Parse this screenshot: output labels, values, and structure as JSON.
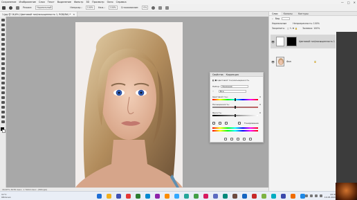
{
  "menubar": {
    "items": [
      "Сохранение",
      "Изображение",
      "Слои",
      "Текст",
      "Выделение",
      "Фильтр",
      "3D",
      "Просмотр",
      "Окно",
      "Справка"
    ],
    "window_controls": [
      "—",
      "□",
      "✕"
    ]
  },
  "options_bar": {
    "mode_label": "Режим:",
    "mode_value": "Нормальный",
    "opacity_label": "Непрозр.:",
    "opacity_value": "100%",
    "flow_label": "Наж.:",
    "flow_value": "100%",
    "smoothing_label": "Сглаживание:",
    "smoothing_value": "0%"
  },
  "document_tab": {
    "title": "1.jpg @ 16,6% (Цветовой тон/насыщенность 1, RGB/8#) *",
    "close": "✕"
  },
  "statusbar": {
    "text": "16,67%    3476 пикс. × 5214 пикс. (300 ppi)"
  },
  "right_panel": {
    "tabs": [
      "Слои",
      "Каналы",
      "Контуры"
    ],
    "active_tab": "Слои",
    "filter_label": "Вид",
    "blend_label": "Нормальные",
    "opacity_label": "Непрозрачность: 100%",
    "lock_label": "Закрепить:",
    "fill_label": "Заливка: 100%",
    "layers": [
      {
        "name": "Цветовой тон/насыщенность 1",
        "selected": true
      },
      {
        "name": "Фон",
        "selected": false
      }
    ]
  },
  "properties": {
    "tabs": [
      "Свойства",
      "Коррекция"
    ],
    "title": "Цветовой тон/насыщенность",
    "preset_label": "Набор:",
    "preset_value": "Заказная",
    "channel_value": "Все",
    "hue_label": "Цветовой тон:",
    "hue_value": "0",
    "saturation_label": "Насыщенность:",
    "saturation_value": "0",
    "lightness_label": "Яркость:",
    "lightness_value": "0",
    "colorize_label": "Тонирование",
    "hue_pos": 0.5,
    "saturation_pos": 0.5,
    "lightness_pos": 0.5
  },
  "taskbar": {
    "weather": "11°C",
    "weather_desc": "Облачно",
    "time": "22:40",
    "date": "10.05.2022",
    "app_colors": [
      "#1e6fd6",
      "#f2b01e",
      "#3f51b5",
      "#e53935",
      "#2e7d32",
      "#0288d1",
      "#8e24aa",
      "#fb8c00",
      "#31a8ff",
      "#26a69a",
      "#43a047",
      "#d81b60",
      "#5c6bc0",
      "#00897b",
      "#6d4c41",
      "#1565c0",
      "#c62828",
      "#7cb342",
      "#00acc1",
      "#3949ab",
      "#ef6c00",
      "#1e88e5"
    ]
  }
}
